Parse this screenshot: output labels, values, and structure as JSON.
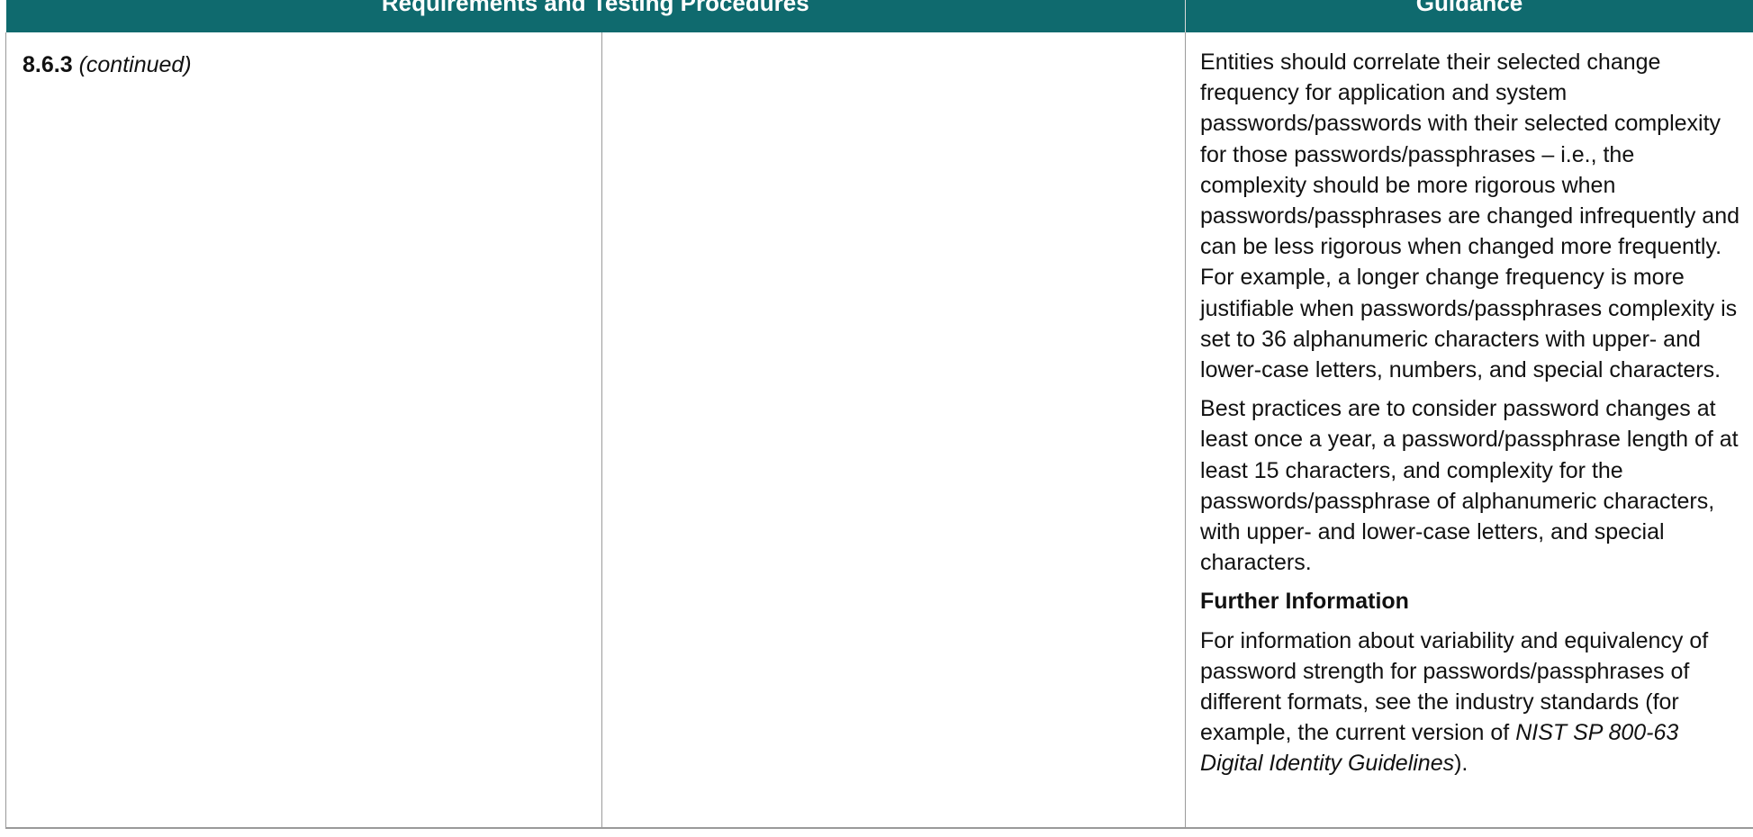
{
  "header": {
    "col_requirements": "Requirements and Testing Procedures",
    "col_guidance": "Guidance"
  },
  "requirement": {
    "id": "8.6.3",
    "continued": "(continued)"
  },
  "guidance": {
    "para1": "Entities should correlate their selected change frequency for application and system passwords/passwords with their selected complexity for those passwords/passphrases – i.e., the complexity should be more rigorous when passwords/passphrases are changed infrequently and can be less rigorous when changed more frequently. For example, a longer change frequency is more justifiable when passwords/passphrases complexity is set to 36 alphanumeric characters with upper- and lower-case letters, numbers, and special characters.",
    "para2": "Best practices are to consider password changes at least once a year, a password/passphrase length of at least 15 characters, and complexity for the passwords/passphrase of alphanumeric characters, with upper- and lower-case letters, and special characters.",
    "further_heading": "Further Information",
    "para3_prefix": "For information about variability and equivalency of password strength for passwords/passphrases of different formats, see the industry standards (for example, the current version of ",
    "para3_citation": "NIST SP 800-63 Digital Identity Guidelines",
    "para3_suffix": ")."
  }
}
